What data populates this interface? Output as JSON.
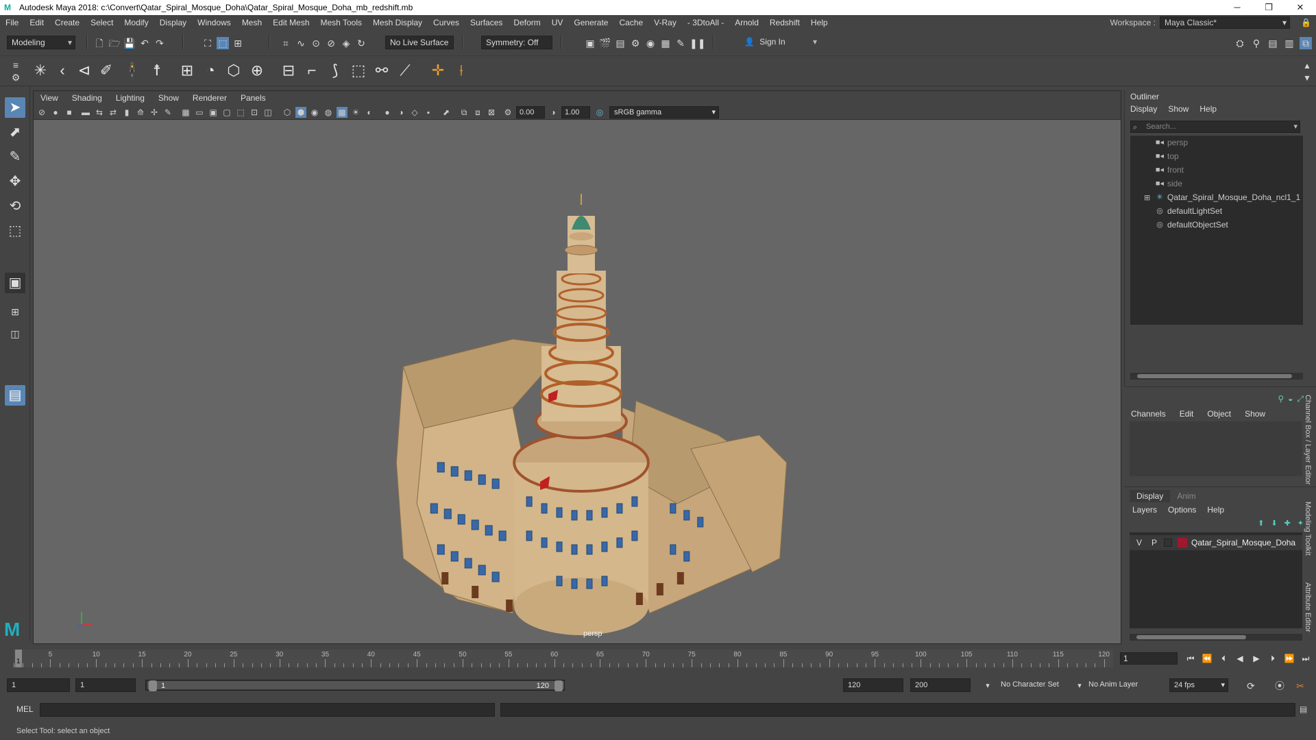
{
  "window": {
    "title": "Autodesk Maya 2018: c:\\Convert\\Qatar_Spiral_Mosque_Doha\\Qatar_Spiral_Mosque_Doha_mb_redshift.mb",
    "minimize": "─",
    "maximize": "❐",
    "close": "✕"
  },
  "menubar": {
    "items": [
      "File",
      "Edit",
      "Create",
      "Select",
      "Modify",
      "Display",
      "Windows",
      "Mesh",
      "Edit Mesh",
      "Mesh Tools",
      "Mesh Display",
      "Curves",
      "Surfaces",
      "Deform",
      "UV",
      "Generate",
      "Cache",
      "V-Ray",
      "- 3DtoAll -",
      "Arnold",
      "Redshift",
      "Help"
    ],
    "workspace_label": "Workspace :",
    "workspace_value": "Maya Classic*"
  },
  "statusline": {
    "mode": "Modeling",
    "live_surface": "No Live Surface",
    "symmetry": "Symmetry: Off",
    "sign_in": "Sign In"
  },
  "viewport": {
    "menu": [
      "View",
      "Shading",
      "Lighting",
      "Show",
      "Renderer",
      "Panels"
    ],
    "exposure": "0.00",
    "gamma": "1.00",
    "color_space": "sRGB gamma",
    "camera_label": "persp"
  },
  "outliner": {
    "title": "Outliner",
    "menu": [
      "Display",
      "Show",
      "Help"
    ],
    "search_placeholder": "Search...",
    "items": [
      {
        "label": "persp",
        "icon": "camera-icon",
        "dim": true
      },
      {
        "label": "top",
        "icon": "camera-icon",
        "dim": true
      },
      {
        "label": "front",
        "icon": "camera-icon",
        "dim": true
      },
      {
        "label": "side",
        "icon": "camera-icon",
        "dim": true
      },
      {
        "label": "Qatar_Spiral_Mosque_Doha_ncl1_1",
        "icon": "group-icon",
        "dim": false,
        "expandable": true
      },
      {
        "label": "defaultLightSet",
        "icon": "set-icon",
        "dim": false
      },
      {
        "label": "defaultObjectSet",
        "icon": "set-icon",
        "dim": false
      }
    ]
  },
  "channelbox": {
    "menu": [
      "Channels",
      "Edit",
      "Object",
      "Show"
    ]
  },
  "layers": {
    "tabs": [
      "Display",
      "Anim"
    ],
    "menu": [
      "Layers",
      "Options",
      "Help"
    ],
    "layer": {
      "v": "V",
      "p": "P",
      "name": "Qatar_Spiral_Mosque_Doha",
      "color": "#a01830"
    }
  },
  "sidetabs": [
    "Channel Box / Layer Editor",
    "Modeling Toolkit",
    "Attribute Editor"
  ],
  "timeslider": {
    "labels": [
      "5",
      "10",
      "15",
      "20",
      "25",
      "30",
      "35",
      "40",
      "45",
      "50",
      "55",
      "60",
      "65",
      "70",
      "75",
      "80",
      "85",
      "90",
      "95",
      "100",
      "105",
      "110",
      "115",
      "120"
    ],
    "current_frame": "1",
    "current_field": "1"
  },
  "rangebar": {
    "start": "1",
    "playback_start": "1",
    "range_start": "1",
    "range_end": "120",
    "playback_end": "120",
    "end": "200",
    "character_set": "No Character Set",
    "anim_layer": "No Anim Layer",
    "fps": "24 fps"
  },
  "cmdline": {
    "label": "MEL"
  },
  "helpline": {
    "text": "Select Tool: select an object"
  },
  "colors": {
    "ui_bg": "#444444",
    "viewport_bg": "#666666",
    "accent": "#5a86b4",
    "building": "#c9a97c"
  }
}
